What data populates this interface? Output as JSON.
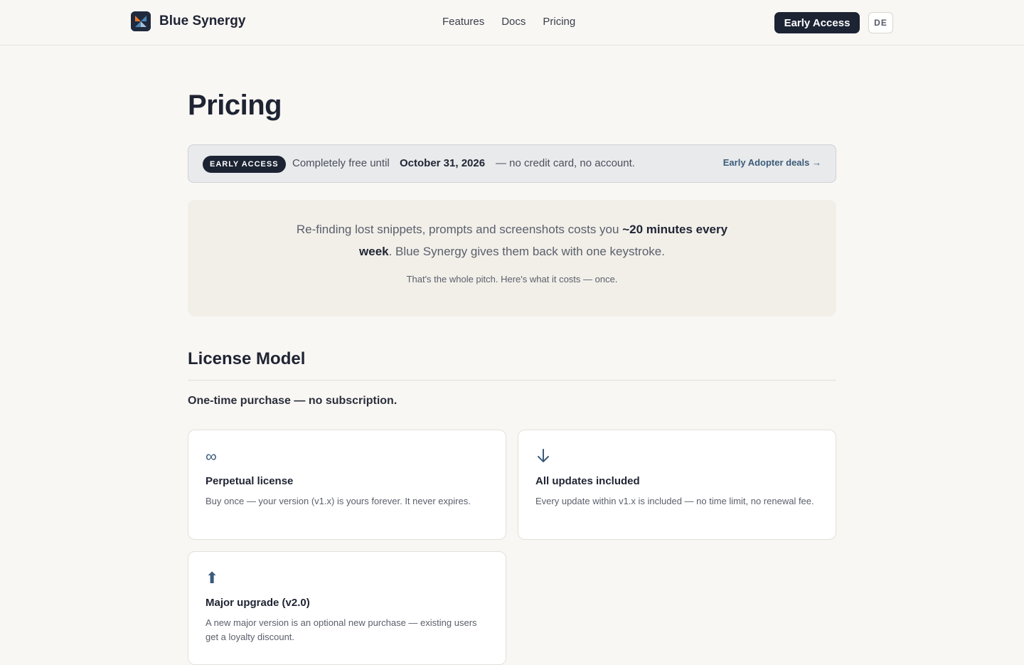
{
  "header": {
    "brand": "Blue Synergy",
    "nav": [
      "Features",
      "Docs",
      "Pricing"
    ],
    "cta": "Early Access",
    "lang": "DE"
  },
  "page": {
    "title": "Pricing"
  },
  "banner": {
    "badge": "EARLY ACCESS",
    "text": "Completely free until",
    "date": "October 31, 2026",
    "rest": "— no credit card, no account.",
    "link": "Early Adopter deals →"
  },
  "pitch": {
    "part1": "Re-finding lost snippets, prompts and screenshots costs you ",
    "bold": "~20 minutes every week",
    "part2": ". Blue Synergy gives them back with one keystroke.",
    "sub": "That's the whole pitch. Here's what it costs — once."
  },
  "license": {
    "title": "License Model",
    "lede": "One-time purchase — no subscription.",
    "cards": [
      {
        "icon": "infinity-icon",
        "glyph": "∞",
        "title": "Perpetual license",
        "text": "Buy once — your version (v1.x) is yours forever. It never expires."
      },
      {
        "icon": "arrow-down-icon",
        "glyph": "↓",
        "title": "All updates included",
        "text": "Every update within v1.x is included — no time limit, no renewal fee."
      },
      {
        "icon": "arrow-up-icon",
        "glyph": "⬆",
        "title": "Major upgrade (v2.0)",
        "text": "A new major version is an optional new purchase — existing users get a loyalty discount."
      }
    ]
  }
}
